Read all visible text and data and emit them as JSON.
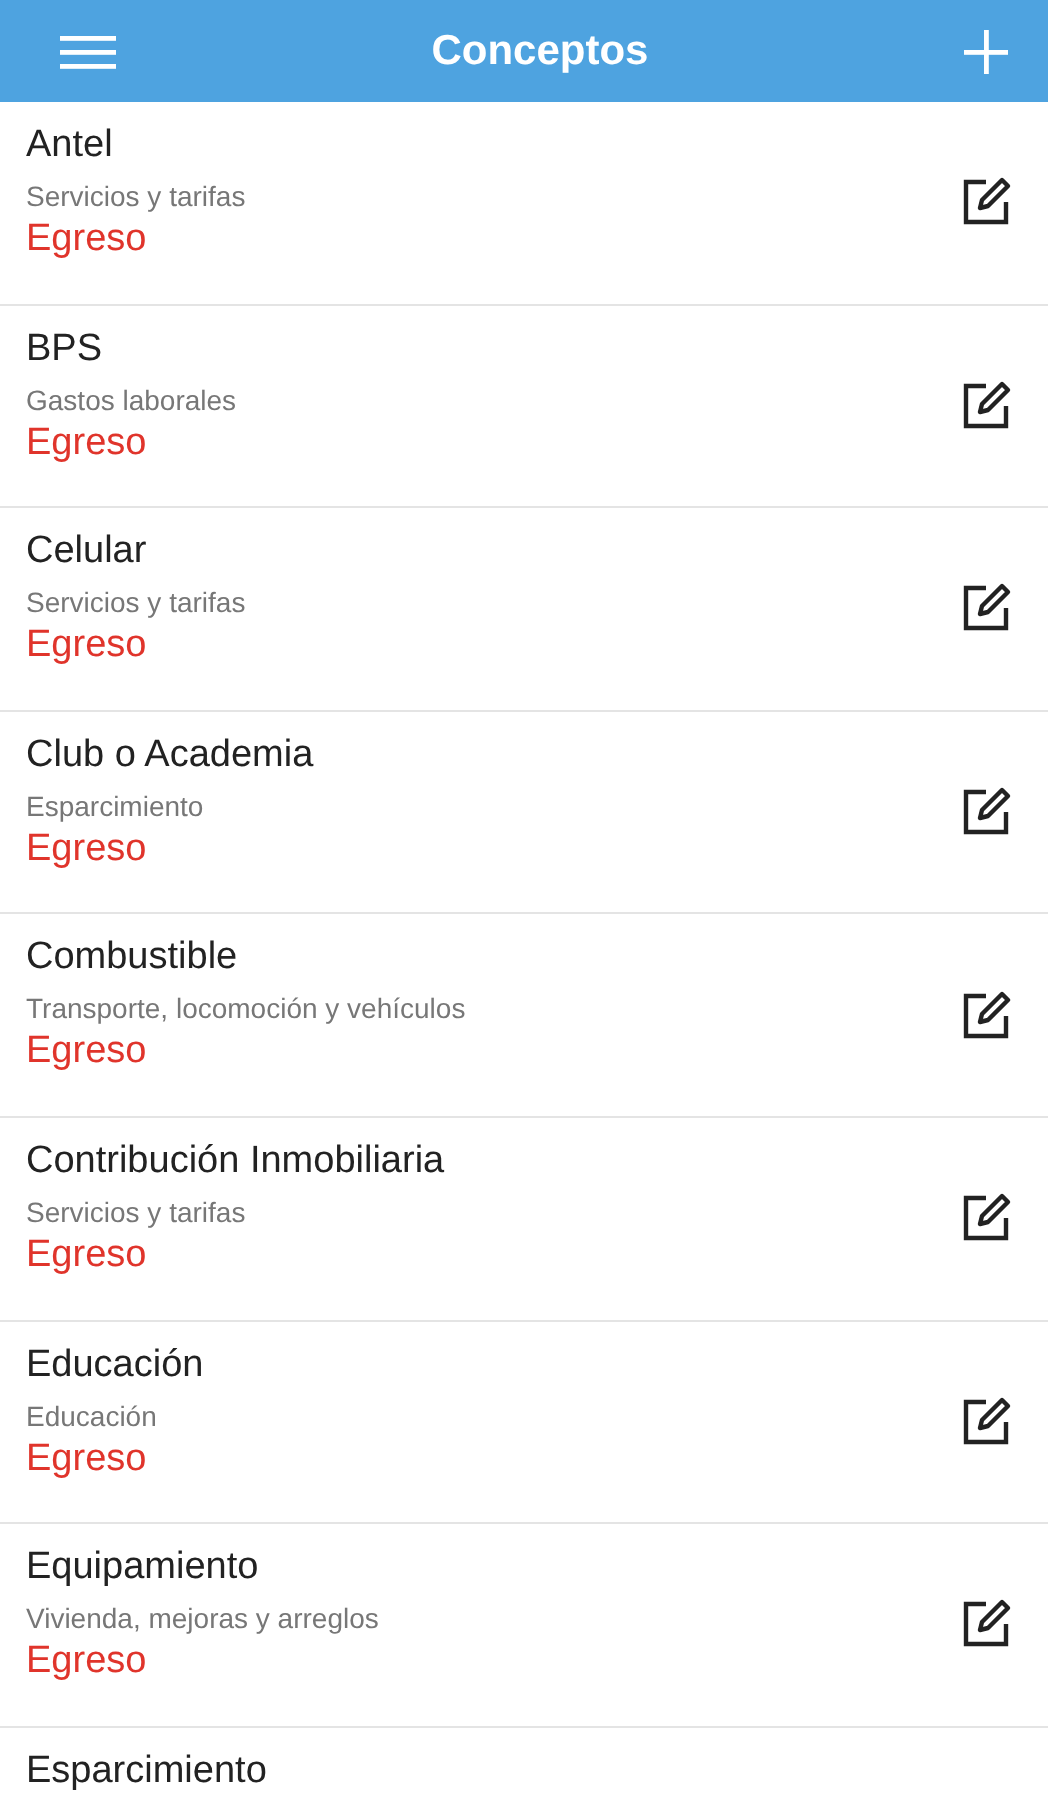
{
  "app_bar": {
    "title": "Conceptos"
  },
  "concepts": [
    {
      "name": "Antel",
      "category": "Servicios y tarifas",
      "type": "Egreso",
      "color": "#e0342b"
    },
    {
      "name": "BPS",
      "category": "Gastos laborales",
      "type": "Egreso",
      "color": "#e0342b"
    },
    {
      "name": "Celular",
      "category": "Servicios y tarifas",
      "type": "Egreso",
      "color": "#e0342b"
    },
    {
      "name": "Club o Academia",
      "category": "Esparcimiento",
      "type": "Egreso",
      "color": "#e0342b"
    },
    {
      "name": "Combustible",
      "category": "Transporte, locomoción y vehículos",
      "type": "Egreso",
      "color": "#e0342b"
    },
    {
      "name": "Contribución Inmobiliaria",
      "category": "Servicios y tarifas",
      "type": "Egreso",
      "color": "#e0342b"
    },
    {
      "name": "Educación",
      "category": "Educación",
      "type": "Egreso",
      "color": "#e0342b"
    },
    {
      "name": "Equipamiento",
      "category": "Vivienda, mejoras y arreglos",
      "type": "Egreso",
      "color": "#e0342b"
    },
    {
      "name": "Esparcimiento"
    }
  ]
}
